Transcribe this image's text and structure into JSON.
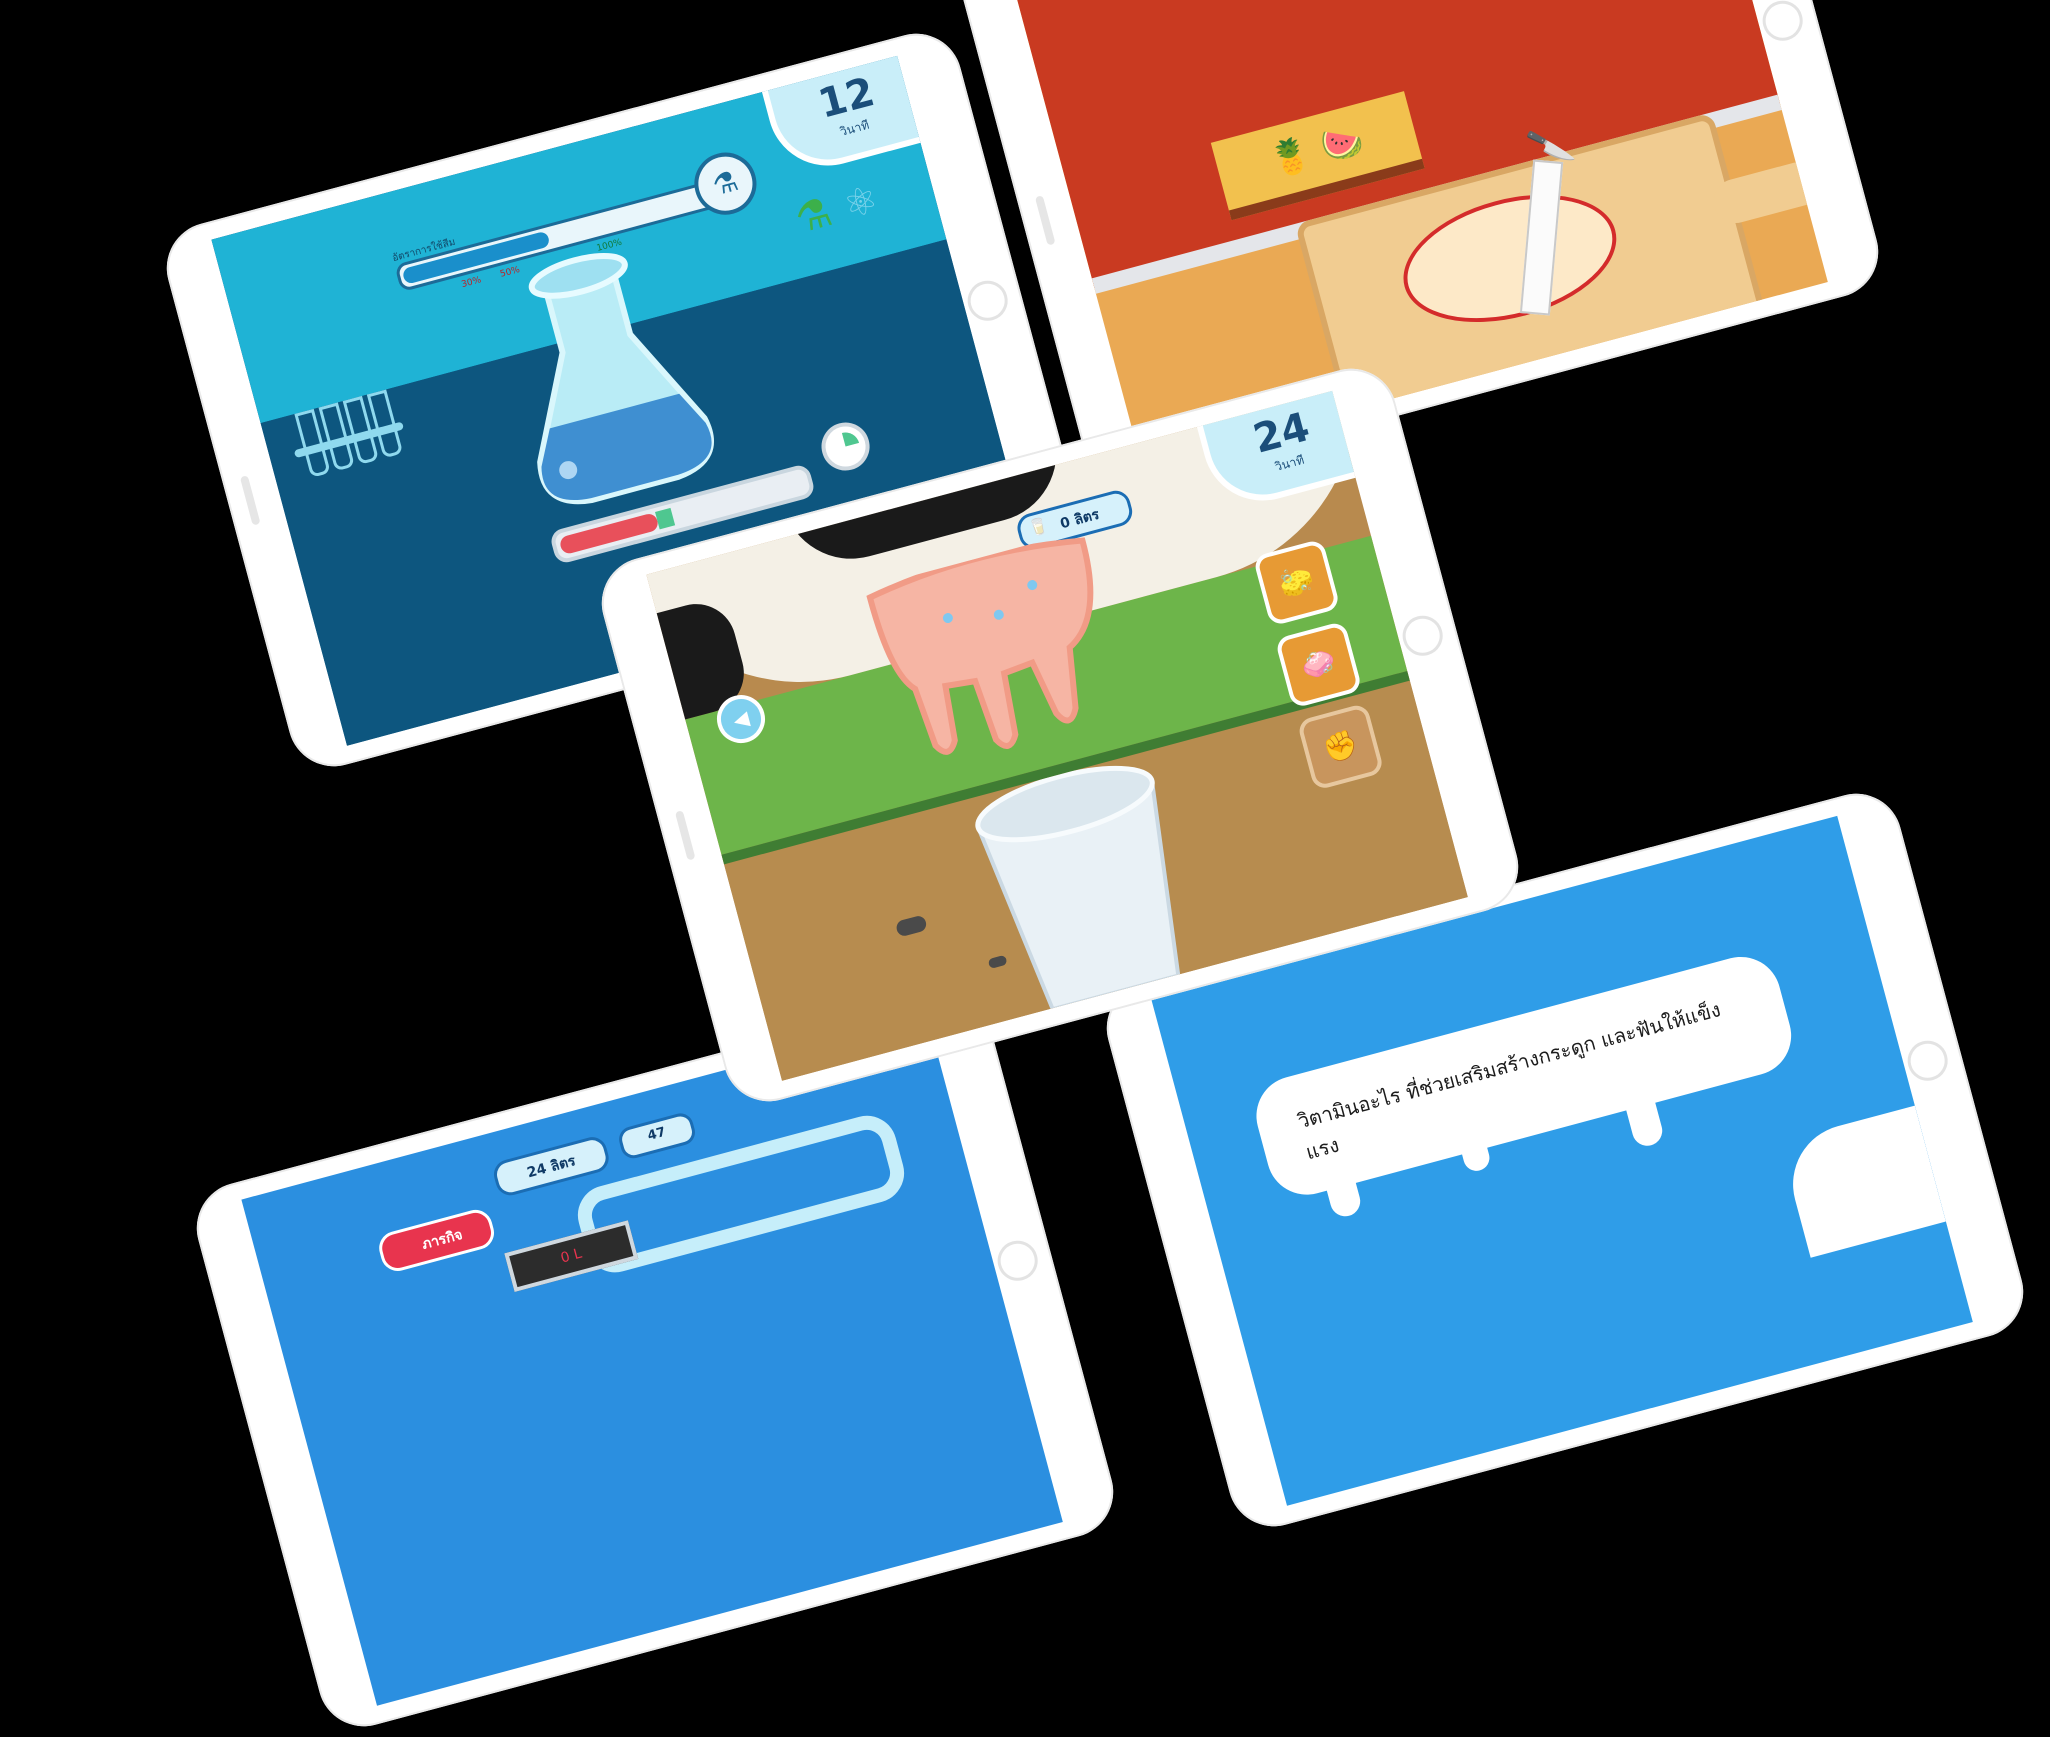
{
  "lab_screen": {
    "timer_value": "12",
    "timer_unit": "วินาที",
    "meter_label": "อัตราการใช้สีม",
    "marks": [
      "30%",
      "50%",
      "100%"
    ],
    "icons": [
      "flask-icon",
      "atom-icon",
      "pie-timer-icon"
    ]
  },
  "kitchen_screen": {
    "icons": [
      "knife-icon",
      "ruler-icon",
      "cutting-board-icon"
    ]
  },
  "milk_screen": {
    "timer_value": "24",
    "timer_unit": "วินาที",
    "milk_amount": "0 ลิตร",
    "tools": [
      "wash-cloth-button",
      "soap-button",
      "hand-button"
    ]
  },
  "factory_screen": {
    "milk_total": "24 ลิตร",
    "counter": "47",
    "mission_label": "ภารกิจ",
    "display_value": "0 L"
  },
  "quiz_screen": {
    "question": "วิตามินอะไร ที่ช่วยเสริมสร้างกระดูก และฟันให้แข็งแรง"
  }
}
